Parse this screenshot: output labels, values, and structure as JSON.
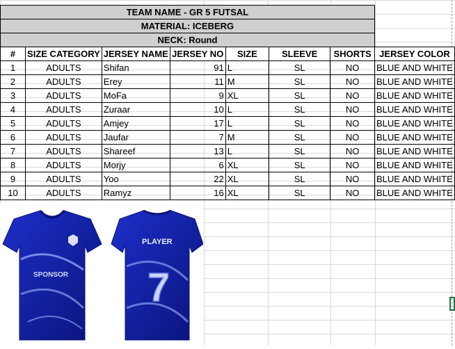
{
  "sheet": {
    "title_team": "TEAM NAME - GR 5 FUTSAL",
    "title_material": "MATERIAL:  ICEBERG",
    "title_neck": "NECK: Round",
    "columns": [
      "#",
      "SIZE CATEGORY",
      "JERSEY NAME",
      "JERSEY NO",
      "SIZE",
      "SLEEVE",
      "SHORTS",
      "JERSEY COLOR"
    ],
    "rows": [
      {
        "num": "1",
        "category": "ADULTS",
        "name": "Shifan",
        "no": "91",
        "size": "L",
        "sleeve": "SL",
        "shorts": "NO",
        "color": "BLUE AND WHITE"
      },
      {
        "num": "2",
        "category": "ADULTS",
        "name": "Erey",
        "no": "11",
        "size": "M",
        "sleeve": "SL",
        "shorts": "NO",
        "color": "BLUE AND WHITE"
      },
      {
        "num": "3",
        "category": "ADULTS",
        "name": "MoFa",
        "no": "9",
        "size": "XL",
        "sleeve": "SL",
        "shorts": "NO",
        "color": "BLUE AND WHITE"
      },
      {
        "num": "4",
        "category": "ADULTS",
        "name": "Zuraar",
        "no": "10",
        "size": "L",
        "sleeve": "SL",
        "shorts": "NO",
        "color": "BLUE AND WHITE"
      },
      {
        "num": "5",
        "category": "ADULTS",
        "name": "Amjey",
        "no": "17",
        "size": "L",
        "sleeve": "SL",
        "shorts": "NO",
        "color": "BLUE AND WHITE"
      },
      {
        "num": "6",
        "category": "ADULTS",
        "name": "Jaufar",
        "no": "7",
        "size": "M",
        "sleeve": "SL",
        "shorts": "NO",
        "color": "BLUE AND WHITE"
      },
      {
        "num": "7",
        "category": "ADULTS",
        "name": "Shareef",
        "no": "13",
        "size": "L",
        "sleeve": "SL",
        "shorts": "NO",
        "color": "BLUE AND WHITE"
      },
      {
        "num": "8",
        "category": "ADULTS",
        "name": "Morjy",
        "no": "6",
        "size": "XL",
        "sleeve": "SL",
        "shorts": "NO",
        "color": "BLUE AND WHITE"
      },
      {
        "num": "9",
        "category": "ADULTS",
        "name": "Yoo",
        "no": "22",
        "size": "XL",
        "sleeve": "SL",
        "shorts": "NO",
        "color": "BLUE AND WHITE"
      },
      {
        "num": "10",
        "category": "ADULTS",
        "name": "Ramyz",
        "no": "16",
        "size": "XL",
        "sleeve": "SL",
        "shorts": "NO",
        "color": "BLUE AND WHITE"
      }
    ]
  },
  "jersey_image": {
    "sponsor_text": "SPONSOR",
    "player_text": "PLAYER",
    "number_text": "7",
    "primary_color": "#1d2fc9",
    "dark_color": "#0a137a",
    "accent_color": "#9fb4ff"
  },
  "colors": {
    "header_fill": "#d0cece",
    "gridline": "#d9d9d9",
    "selection": "#217346"
  }
}
